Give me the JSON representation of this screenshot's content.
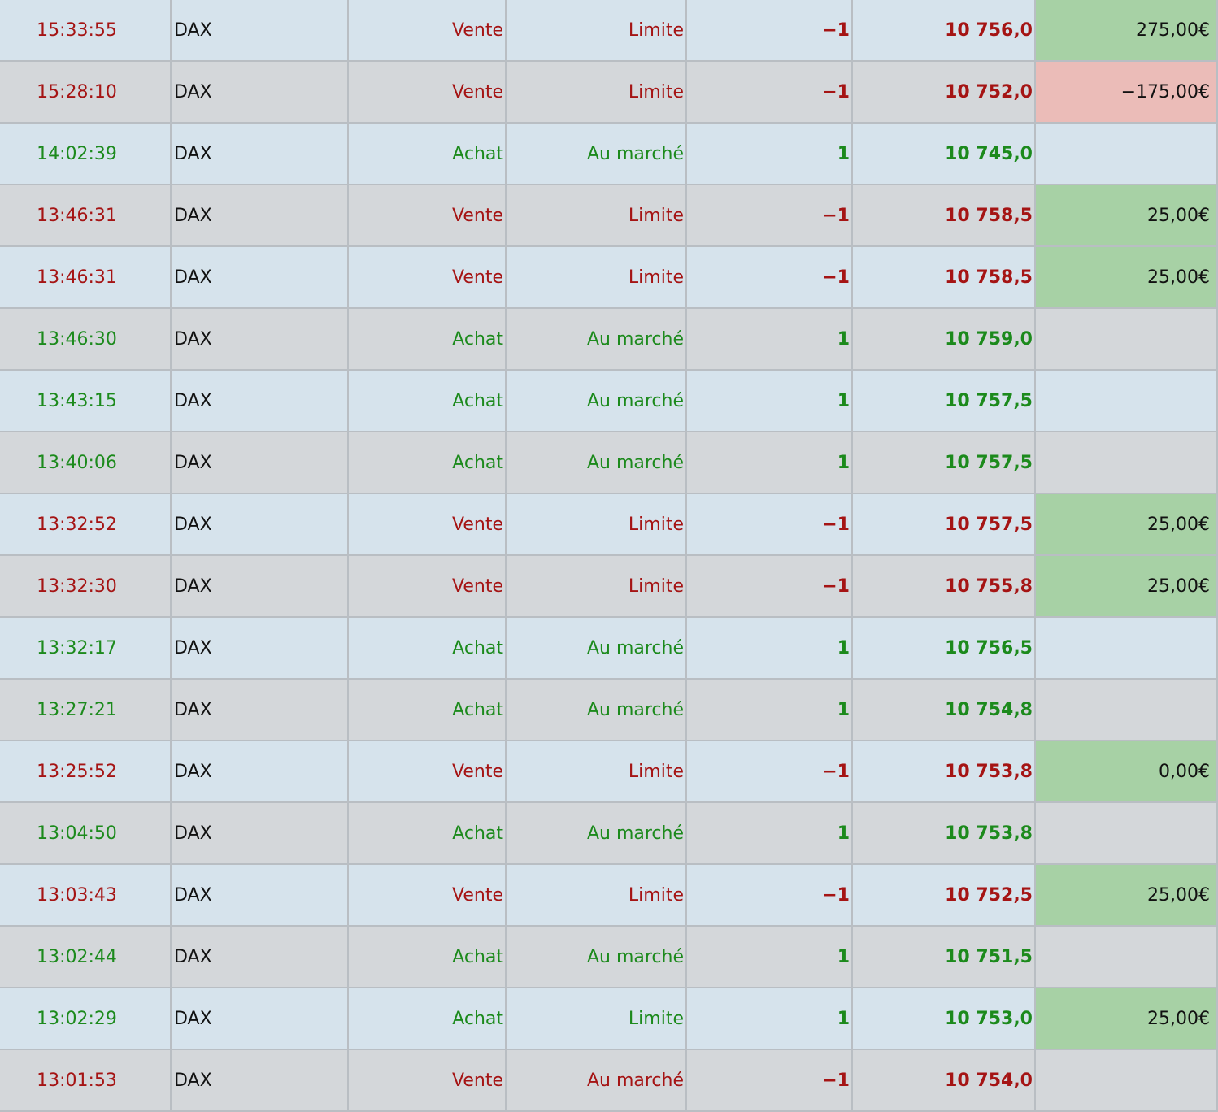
{
  "colors": {
    "buy_text": "#1c8a1c",
    "sell_text": "#a51414",
    "profit_bg": "#a7d1a5",
    "loss_bg": "#ebbcb8",
    "row_light": "#d6e3ec",
    "row_dark": "#d4d7da"
  },
  "trades": [
    {
      "time": "15:33:55",
      "instrument": "DAX",
      "side": "Vente",
      "order_type": "Limite",
      "qty": "−1",
      "price": "10 756,0",
      "pnl": "275,00€",
      "pnl_state": "pos"
    },
    {
      "time": "15:28:10",
      "instrument": "DAX",
      "side": "Vente",
      "order_type": "Limite",
      "qty": "−1",
      "price": "10 752,0",
      "pnl": "−175,00€",
      "pnl_state": "neg"
    },
    {
      "time": "14:02:39",
      "instrument": "DAX",
      "side": "Achat",
      "order_type": "Au marché",
      "qty": "1",
      "price": "10 745,0",
      "pnl": "",
      "pnl_state": "none"
    },
    {
      "time": "13:46:31",
      "instrument": "DAX",
      "side": "Vente",
      "order_type": "Limite",
      "qty": "−1",
      "price": "10 758,5",
      "pnl": "25,00€",
      "pnl_state": "pos"
    },
    {
      "time": "13:46:31",
      "instrument": "DAX",
      "side": "Vente",
      "order_type": "Limite",
      "qty": "−1",
      "price": "10 758,5",
      "pnl": "25,00€",
      "pnl_state": "pos"
    },
    {
      "time": "13:46:30",
      "instrument": "DAX",
      "side": "Achat",
      "order_type": "Au marché",
      "qty": "1",
      "price": "10 759,0",
      "pnl": "",
      "pnl_state": "none"
    },
    {
      "time": "13:43:15",
      "instrument": "DAX",
      "side": "Achat",
      "order_type": "Au marché",
      "qty": "1",
      "price": "10 757,5",
      "pnl": "",
      "pnl_state": "none"
    },
    {
      "time": "13:40:06",
      "instrument": "DAX",
      "side": "Achat",
      "order_type": "Au marché",
      "qty": "1",
      "price": "10 757,5",
      "pnl": "",
      "pnl_state": "none"
    },
    {
      "time": "13:32:52",
      "instrument": "DAX",
      "side": "Vente",
      "order_type": "Limite",
      "qty": "−1",
      "price": "10 757,5",
      "pnl": "25,00€",
      "pnl_state": "pos"
    },
    {
      "time": "13:32:30",
      "instrument": "DAX",
      "side": "Vente",
      "order_type": "Limite",
      "qty": "−1",
      "price": "10 755,8",
      "pnl": "25,00€",
      "pnl_state": "pos"
    },
    {
      "time": "13:32:17",
      "instrument": "DAX",
      "side": "Achat",
      "order_type": "Au marché",
      "qty": "1",
      "price": "10 756,5",
      "pnl": "",
      "pnl_state": "none"
    },
    {
      "time": "13:27:21",
      "instrument": "DAX",
      "side": "Achat",
      "order_type": "Au marché",
      "qty": "1",
      "price": "10 754,8",
      "pnl": "",
      "pnl_state": "none"
    },
    {
      "time": "13:25:52",
      "instrument": "DAX",
      "side": "Vente",
      "order_type": "Limite",
      "qty": "−1",
      "price": "10 753,8",
      "pnl": "0,00€",
      "pnl_state": "pos"
    },
    {
      "time": "13:04:50",
      "instrument": "DAX",
      "side": "Achat",
      "order_type": "Au marché",
      "qty": "1",
      "price": "10 753,8",
      "pnl": "",
      "pnl_state": "none"
    },
    {
      "time": "13:03:43",
      "instrument": "DAX",
      "side": "Vente",
      "order_type": "Limite",
      "qty": "−1",
      "price": "10 752,5",
      "pnl": "25,00€",
      "pnl_state": "pos"
    },
    {
      "time": "13:02:44",
      "instrument": "DAX",
      "side": "Achat",
      "order_type": "Au marché",
      "qty": "1",
      "price": "10 751,5",
      "pnl": "",
      "pnl_state": "none"
    },
    {
      "time": "13:02:29",
      "instrument": "DAX",
      "side": "Achat",
      "order_type": "Limite",
      "qty": "1",
      "price": "10 753,0",
      "pnl": "25,00€",
      "pnl_state": "pos"
    },
    {
      "time": "13:01:53",
      "instrument": "DAX",
      "side": "Vente",
      "order_type": "Au marché",
      "qty": "−1",
      "price": "10 754,0",
      "pnl": "",
      "pnl_state": "none"
    }
  ]
}
